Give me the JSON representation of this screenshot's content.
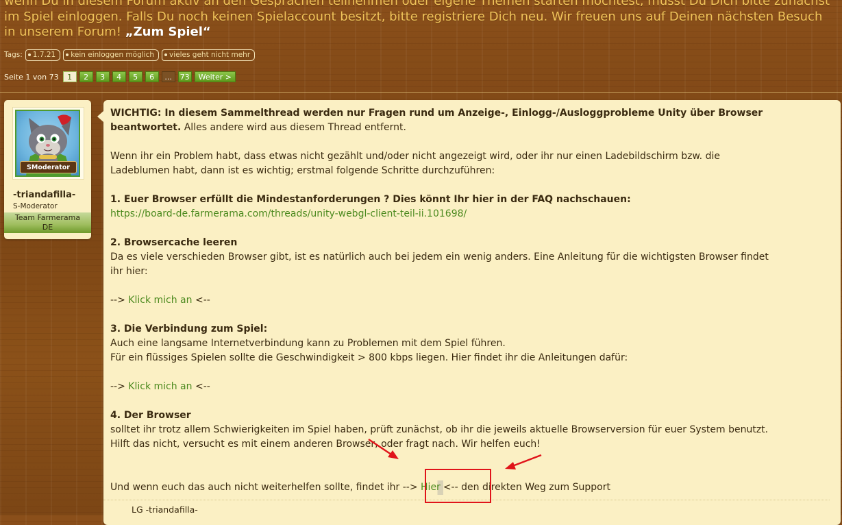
{
  "intro": {
    "line1": "wenn Du in diesem Forum aktiv an den Gesprächen teilnehmen oder eigene Themen starten möchtest, musst Du Dich bitte zunächst",
    "line2": "im Spiel einloggen. Falls Du noch keinen Spielaccount besitzt, bitte registriere Dich neu. Wir freuen uns auf Deinen nächsten Besuch",
    "line3_prefix": "in unserem Forum!",
    "game_link": "„Zum Spiel“"
  },
  "tags": {
    "label": "Tags:",
    "items": [
      "1.7.21",
      "kein einloggen möglich",
      "vieles geht nicht mehr"
    ]
  },
  "pagination": {
    "label": "Seite 1 von 73",
    "pages": [
      "1",
      "2",
      "3",
      "4",
      "5",
      "6"
    ],
    "current": "1",
    "dots": "...",
    "last": "73",
    "next": "Weiter >"
  },
  "author": {
    "name": "-triandafilla-",
    "rank": "S-Moderator",
    "badge": "SModerator",
    "team_line1": "Team Farmerama",
    "team_line2": "DE"
  },
  "post": {
    "p1_bold": "WICHTIG: In diesem Sammelthread werden nur Fragen rund um Anzeige-, Einlogg-/Ausloggprobleme Unity über Browser beantwortet.",
    "p1_rest": " Alles andere wird aus diesem Thread entfernt.",
    "p2_line1": "Wenn ihr ein Problem habt, dass etwas nicht gezählt und/oder nicht angezeigt wird, oder ihr nur einen Ladebildschirm bzw. die",
    "p2_line2": "Ladeblumen habt, dann ist es wichtig; erstmal folgende Schritte durchzuführen:",
    "s1_title": "1. Euer Browser erfüllt die Mindestanforderungen ? Dies könnt Ihr hier in der FAQ nachschauen:",
    "s1_link": "https://board-de.farmerama.com/threads/unity-webgl-client-teil-ii.101698/",
    "s2_title": "2. Browsercache leeren",
    "s2_line1": "Da es viele verschieden Browser gibt, ist es natürlich auch bei jedem ein wenig anders. Eine Anleitung für die wichtigsten Browser findet",
    "s2_line2": "ihr hier:",
    "arrow_left": "-->",
    "arrow_right": "<--",
    "klick_link": "Klick mich an",
    "s3_title": "3. Die Verbindung zum Spiel:",
    "s3_line1": "Auch eine langsame Internetverbindung kann zu Problemen mit dem Spiel führen.",
    "s3_line2": "Für ein flüssiges Spielen sollte die Geschwindigkeit > 800 kbps liegen. Hier findet ihr die Anleitungen dafür:",
    "s4_title": "4. Der Browser",
    "s4_line1": "solltet ihr trotz allem Schwierigkeiten im Spiel haben, prüft zunächst, ob ihr die jeweils aktuelle Browserversion für euer System benutzt.",
    "s4_line2": "Hilft das nicht, versucht es mit einem anderen Browser, oder fragt nach. Wir helfen euch!",
    "final_prefix": "Und wenn euch das auch nicht weiterhelfen sollte, findet ihr",
    "hier_link": "Hier",
    "final_suffix": "den direkten Weg zum Support",
    "signature": "LG -triandafilla-"
  },
  "colors": {
    "annotation_red": "#e0141a",
    "link_green": "#4c8a1f",
    "intro_gold": "#f0c35a"
  }
}
